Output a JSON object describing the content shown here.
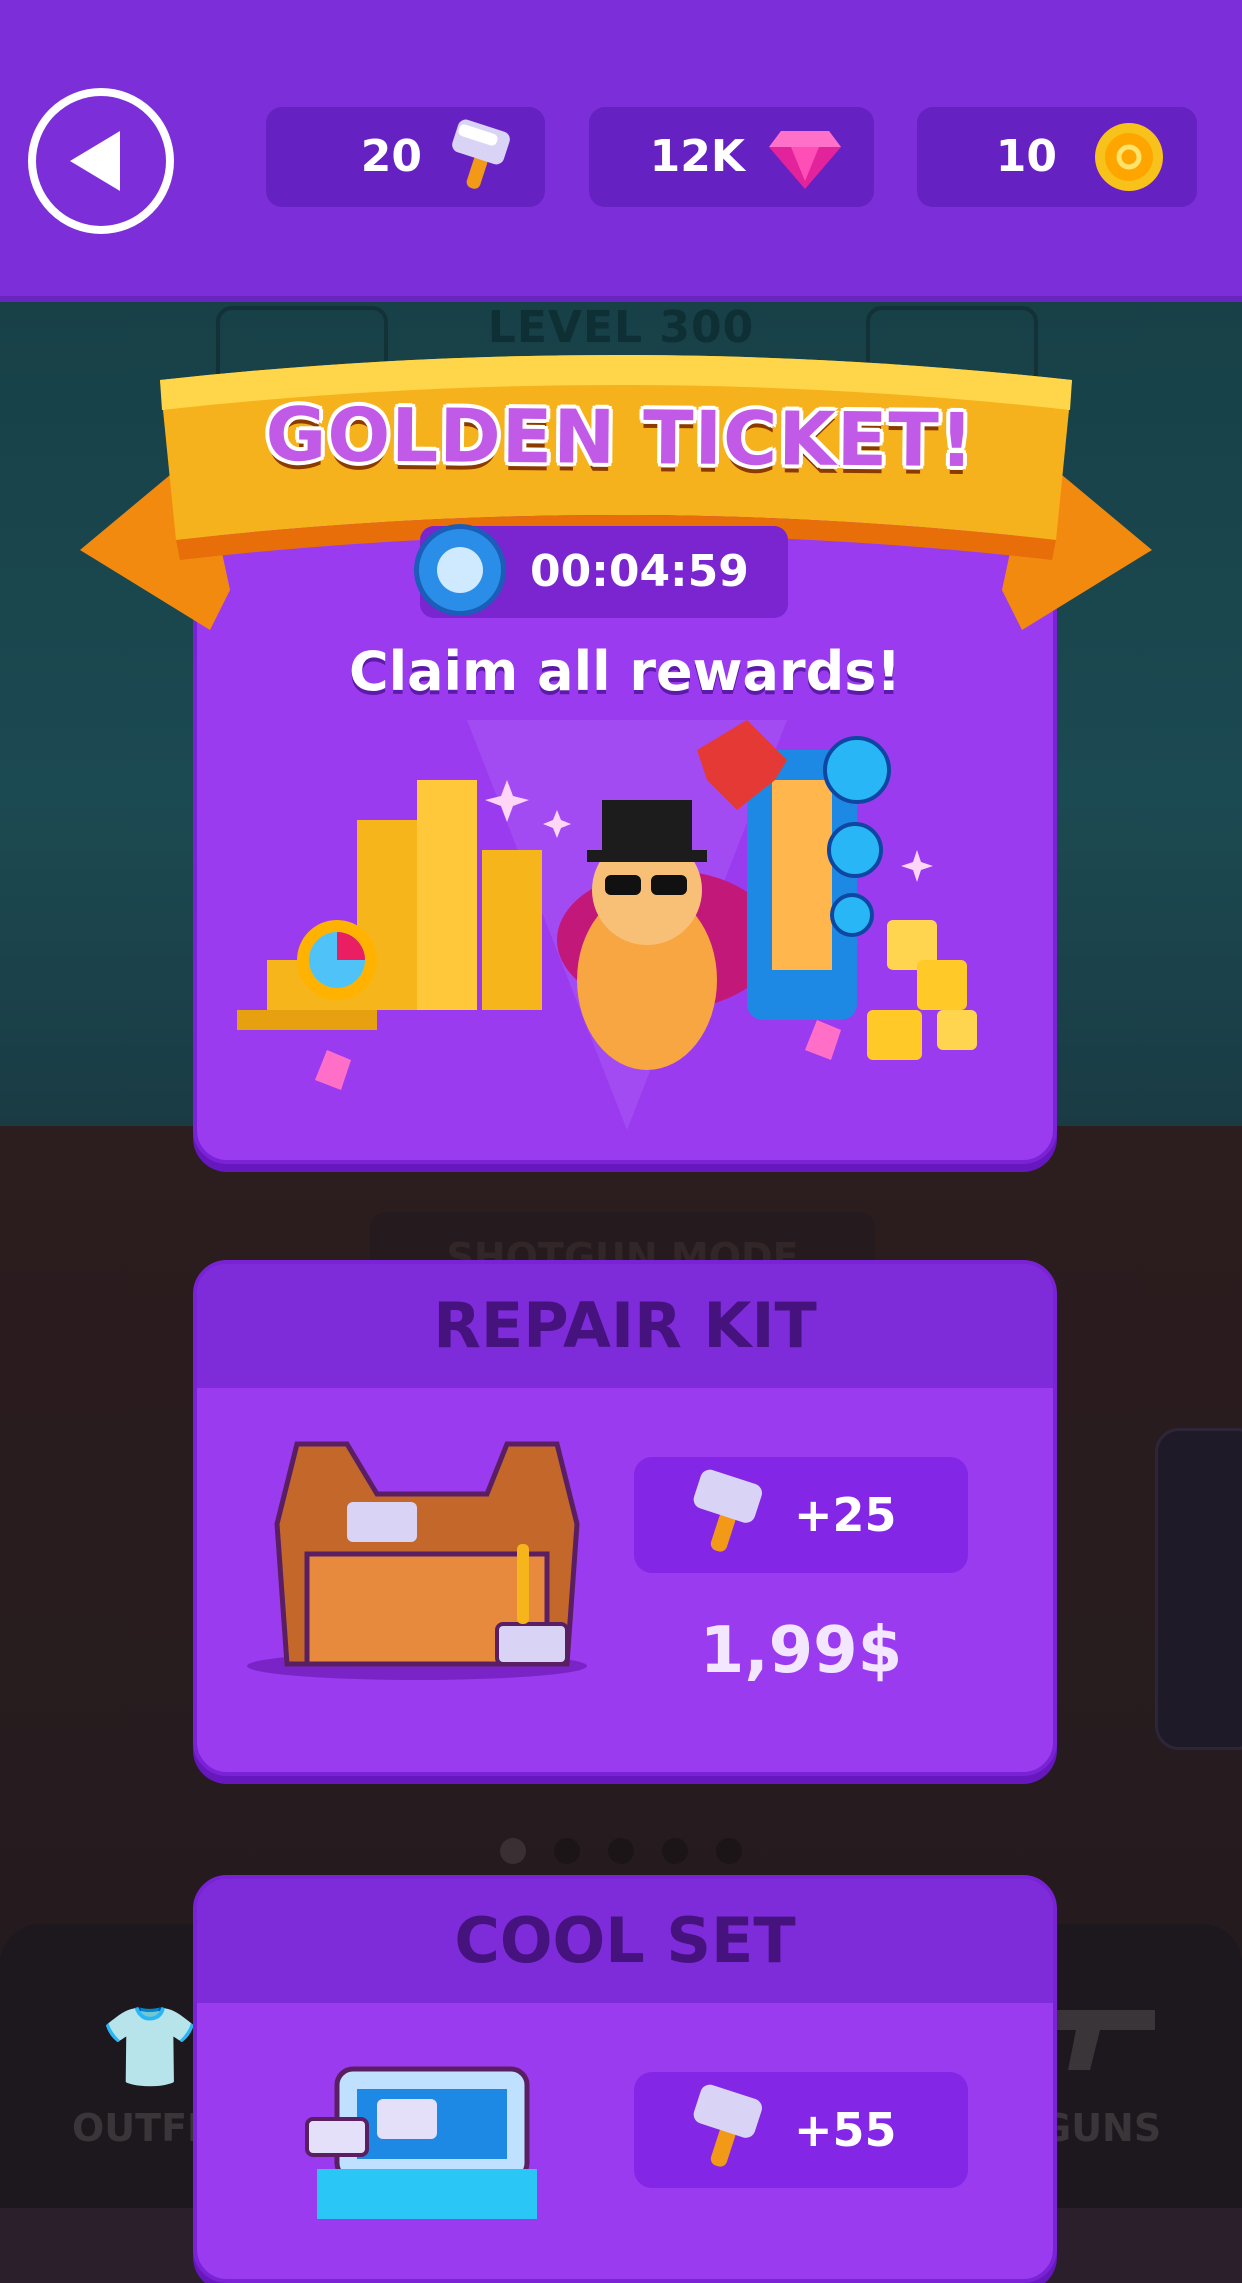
{
  "top_bar": {
    "hammers": "20",
    "gems": "12K",
    "coins": "10",
    "back_icon": "back-arrow-icon",
    "hammer_icon": "hammer-icon",
    "gem_icon": "gem-icon",
    "coin_icon": "coin-icon"
  },
  "background": {
    "level": "LEVEL 300",
    "mode": "SHOTGUN MODE",
    "nav_left": "OUTFI",
    "nav_right": "GUNS"
  },
  "golden_ticket": {
    "title": "GOLDEN TICKET!",
    "timer": "00:04:59",
    "subtitle": "Claim all rewards!"
  },
  "offers": [
    {
      "title": "REPAIR KIT",
      "reward": "+25",
      "price": "1,99$"
    },
    {
      "title": "COOL SET",
      "reward": "+55"
    }
  ],
  "colors": {
    "top_bar": "#7c2fd9",
    "panel": "#9b3bf0",
    "ribbon": "#f6b21c"
  }
}
